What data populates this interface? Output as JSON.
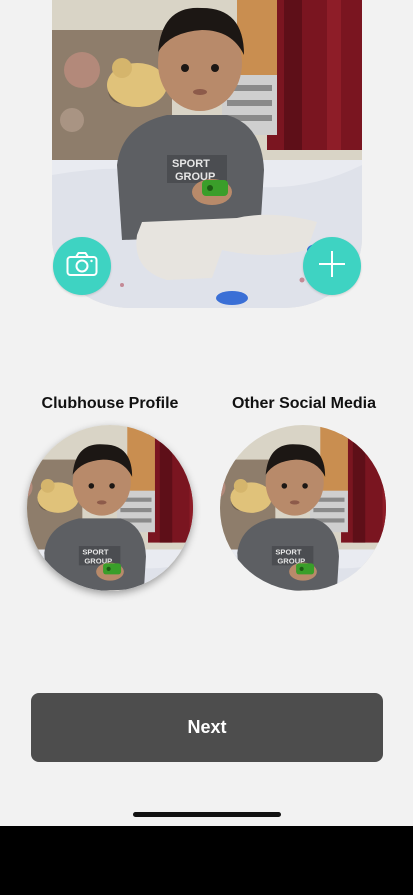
{
  "profile_photo": {
    "alt": "photo"
  },
  "actions": {
    "camera_icon": "camera-icon",
    "add_icon": "plus-icon"
  },
  "previews": {
    "clubhouse_label": "Clubhouse Profile",
    "other_label": "Other Social Media"
  },
  "next_label": "Next",
  "colors": {
    "accent": "#3ed3c2",
    "button_bg": "#4d4d4d",
    "background": "#f2f2f2"
  }
}
